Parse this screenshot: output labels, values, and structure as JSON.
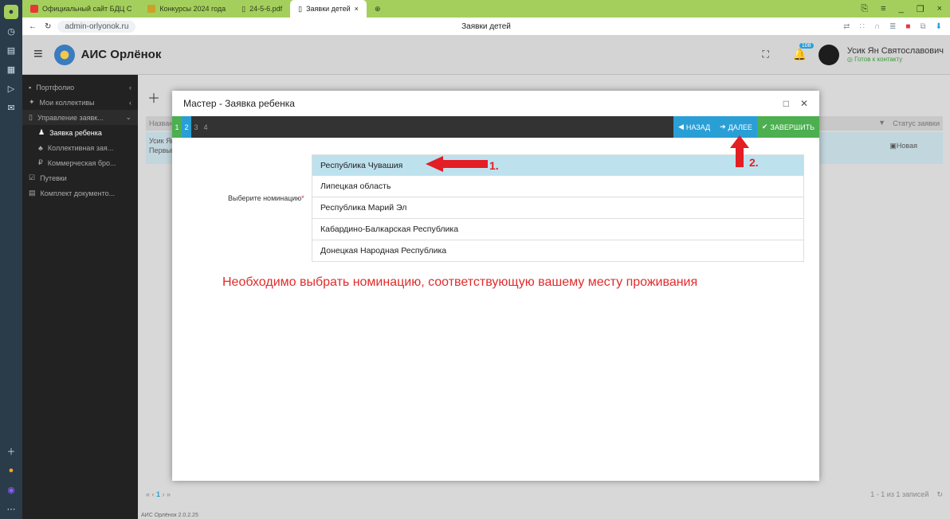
{
  "browser": {
    "tabs": [
      {
        "label": "Официальный сайт БДЦ С",
        "color": "#e53935"
      },
      {
        "label": "Конкурсы 2024 года",
        "color": "#c9a227"
      },
      {
        "label": "24-5-6.pdf",
        "color": "#555555"
      },
      {
        "label": "Заявки детей",
        "color": "#555555",
        "active": true
      }
    ],
    "url": "admin-orlyonok.ru",
    "page_title": "Заявки детей"
  },
  "app": {
    "name": "АИС Орлёнок",
    "notif_count": "108",
    "user_name": "Усик Ян Святославович",
    "user_status": "Готов к контакту",
    "version": "АИС Орлёнок 2.0.2.25"
  },
  "sidebar": {
    "items": [
      {
        "label": "Портфолио",
        "icon": "briefcase-icon",
        "arrow": "‹"
      },
      {
        "label": "Мои коллективы",
        "icon": "users-icon",
        "arrow": "‹"
      },
      {
        "label": "Управление заявк...",
        "icon": "doc-icon",
        "arrow": "⌄"
      },
      {
        "label": "Заявка ребенка",
        "icon": "user-icon",
        "sub": true,
        "active": true
      },
      {
        "label": "Коллективная зая...",
        "icon": "group-icon",
        "sub": true
      },
      {
        "label": "Коммерческая бро...",
        "icon": "ruble-icon",
        "sub": true
      },
      {
        "label": "Путевки",
        "icon": "ticket-icon"
      },
      {
        "label": "Комплект документо...",
        "icon": "folder-icon"
      }
    ]
  },
  "table": {
    "header_left": "Назван",
    "header_right": "Статус заявки",
    "row_name": "Усик Ян",
    "row_sub": "Первый",
    "row_status": "Новая",
    "pager_info": "1 - 1 из 1 записей",
    "page": "1"
  },
  "modal": {
    "title": "Мастер - Заявка ребенка",
    "steps": [
      "1",
      "2",
      "3",
      "4"
    ],
    "back_label": "НАЗАД",
    "next_label": "ДАЛЕЕ",
    "finish_label": "ЗАВЕРШИТЬ",
    "field_label": "Выберите номинацию",
    "options": [
      "Республика Чувашия",
      "Липецкая область",
      "Республика Марий Эл",
      "Кабардино-Балкарская Республика",
      "Донецкая Народная Республика"
    ],
    "selected": "Республика Чувашия",
    "hint": "Необходимо выбрать номинацию, соответствующую вашему месту проживания"
  },
  "annotations": {
    "first": "1.",
    "second": "2."
  }
}
